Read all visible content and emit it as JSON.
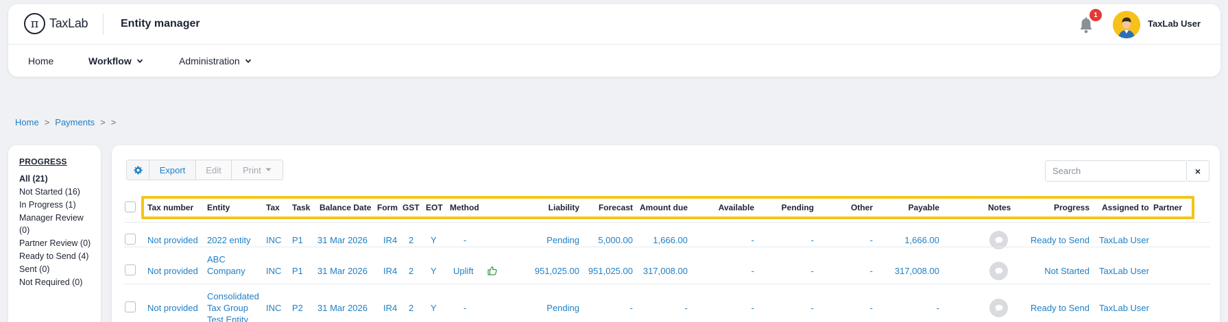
{
  "brand": {
    "name": "TaxLab",
    "logo_glyph": "π"
  },
  "app_title": "Entity manager",
  "notifications": {
    "count": "1"
  },
  "user": {
    "name": "TaxLab User"
  },
  "nav": {
    "home": "Home",
    "workflow": "Workflow",
    "administration": "Administration"
  },
  "breadcrumb": {
    "home": "Home",
    "sep1": ">",
    "payments": "Payments",
    "sep2": ">",
    "sep3": ">"
  },
  "progress_panel": {
    "title": "PROGRESS",
    "items": [
      "All (21)",
      "Not Started (16)",
      "In Progress (1)",
      "Manager Review (0)",
      "Partner Review (0)",
      "Ready to Send (4)",
      "Sent (0)",
      "Not Required (0)"
    ]
  },
  "toolbar": {
    "export": "Export",
    "edit": "Edit",
    "print": "Print"
  },
  "search": {
    "placeholder": "Search",
    "clear": "×"
  },
  "table": {
    "columns": {
      "tax_number": "Tax number",
      "entity": "Entity",
      "tax": "Tax",
      "task": "Task",
      "balance_date": "Balance Date",
      "form": "Form",
      "gst": "GST",
      "eot": "EOT",
      "method": "Method",
      "liability": "Liability",
      "forecast": "Forecast",
      "amount_due": "Amount due",
      "available": "Available",
      "pending": "Pending",
      "other": "Other",
      "payable": "Payable",
      "notes": "Notes",
      "progress": "Progress",
      "assigned_to": "Assigned to",
      "partner": "Partner"
    },
    "rows": [
      {
        "tax_number": "Not provided",
        "entity": "2022 entity",
        "tax": "INC",
        "task": "P1",
        "balance_date": "31 Mar 2026",
        "form": "IR4",
        "gst": "2",
        "eot": "Y",
        "method": "-",
        "liability": "Pending",
        "forecast": "5,000.00",
        "amount_due": "1,666.00",
        "available": "-",
        "pending": "-",
        "other": "-",
        "payable": "1,666.00",
        "progress": "Ready to Send",
        "assigned_to": "TaxLab User"
      },
      {
        "tax_number": "Not provided",
        "entity": "ABC Company",
        "tax": "INC",
        "task": "P1",
        "balance_date": "31 Mar 2026",
        "form": "IR4",
        "gst": "2",
        "eot": "Y",
        "method": "Uplift",
        "liability": "951,025.00",
        "forecast": "951,025.00",
        "amount_due": "317,008.00",
        "available": "-",
        "pending": "-",
        "other": "-",
        "payable": "317,008.00",
        "progress": "Not Started",
        "assigned_to": "TaxLab User"
      },
      {
        "tax_number": "Not provided",
        "entity": "Consolidated Tax Group Test Entity",
        "tax": "INC",
        "task": "P2",
        "balance_date": "31 Mar 2026",
        "form": "IR4",
        "gst": "2",
        "eot": "Y",
        "method": "-",
        "liability": "Pending",
        "forecast": "-",
        "amount_due": "-",
        "available": "-",
        "pending": "-",
        "other": "-",
        "payable": "-",
        "progress": "Ready to Send",
        "assigned_to": "TaxLab User"
      }
    ]
  },
  "colors": {
    "link": "#1f7fc4",
    "highlight": "#f5c518",
    "badge": "#e53935",
    "avatar_bg": "#f6c21a",
    "thumbs_up": "#2e9b3a"
  }
}
